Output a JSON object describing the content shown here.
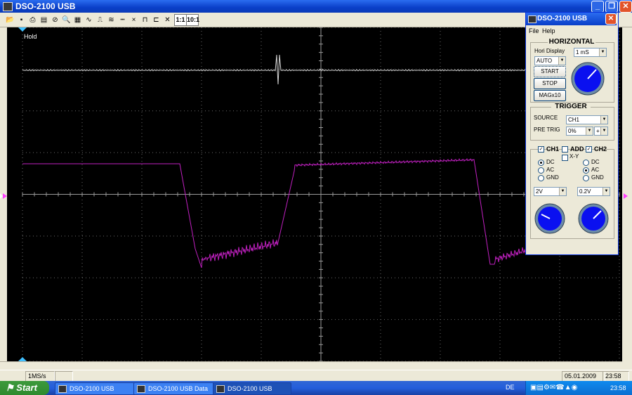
{
  "window": {
    "title": "DSO-2100 USB"
  },
  "toolbar": {
    "ratio_1": "1:1",
    "ratio_10": "10:1"
  },
  "scope": {
    "hold_label": "Hold",
    "colors": {
      "background": "#000000",
      "grid": "#6a6a6a",
      "ch1": "#c020c0",
      "ch2": "#d8d8d8"
    }
  },
  "status": {
    "sample_rate": "1MS/s",
    "date": "05.01.2009",
    "time": "23:58"
  },
  "taskbar": {
    "start_label": "Start",
    "tasks": [
      "DSO-2100 USB",
      "DSO-2100 USB Data",
      "DSO-2100 USB"
    ],
    "language": "DE",
    "clock": "23:58"
  },
  "panel": {
    "title": "DSO-2100 USB",
    "menu": [
      "File",
      "Help"
    ],
    "horizontal": {
      "heading": "HORIZONTAL",
      "hori_display_label": "Hori Display",
      "timebase": "1 mS",
      "mode": "AUTO",
      "start": "START",
      "stop": "STOP",
      "mag": "MAGx10"
    },
    "trigger": {
      "heading": "TRIGGER",
      "source_label": "SOURCE",
      "source": "CH1",
      "pretrig_label": "PRE TRIG",
      "pretrig": "0%",
      "slope": "+"
    },
    "channels": {
      "ch1": "CH1",
      "add": "ADD",
      "xy": "X-Y",
      "ch2": "CH2",
      "dc": "DC",
      "ac": "AC",
      "gnd": "GND",
      "ch1_volts": "2V",
      "ch2_volts": "0.2V"
    }
  }
}
